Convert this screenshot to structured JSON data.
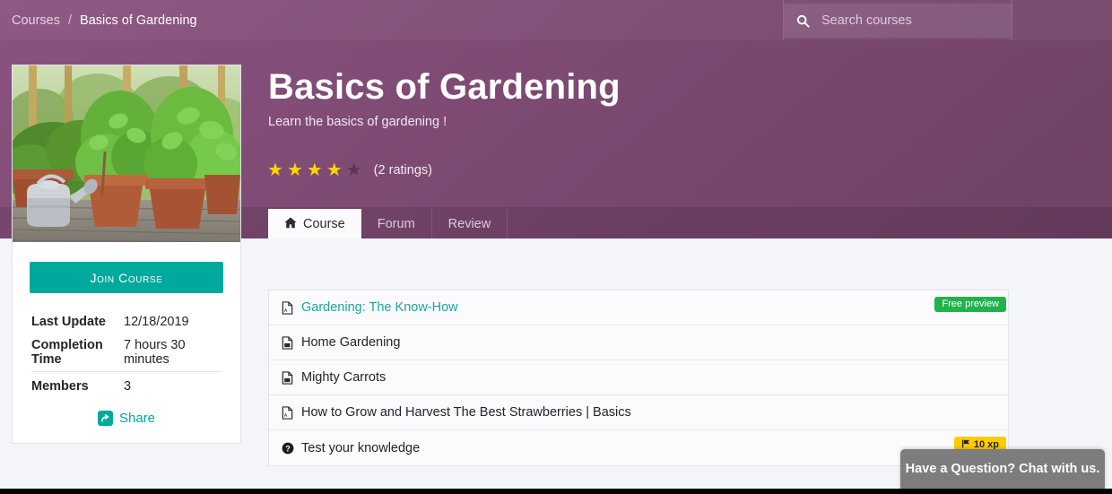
{
  "breadcrumb": {
    "root_label": "Courses",
    "separator": "/",
    "current_label": "Basics of Gardening"
  },
  "search": {
    "placeholder": "Search courses",
    "value": "",
    "icon": "search-icon"
  },
  "hero": {
    "title": "Basics of Gardening",
    "subtitle": "Learn the basics of gardening !",
    "rating_value": 4,
    "rating_max": 5,
    "rating_count_label": "(2 ratings)",
    "star_filled_color": "#ffd400",
    "star_empty_color": "#5d3556",
    "background_color": "#7d4a72"
  },
  "tabs": [
    {
      "label": "Course",
      "icon": "home-icon",
      "active": true
    },
    {
      "label": "Forum",
      "icon": "",
      "active": false
    },
    {
      "label": "Review",
      "icon": "",
      "active": false
    }
  ],
  "sidebar": {
    "thumbnail_alt": "potted garden plants with watering can on a wooden deck",
    "join_button_label": "Join Course",
    "join_button_color": "#00a99d",
    "meta": [
      {
        "key": "Last Update",
        "value": "12/18/2019",
        "divider_above": false
      },
      {
        "key": "Completion Time",
        "value": "7 hours 30 minutes",
        "divider_above": false
      },
      {
        "key": "Members",
        "value": "3",
        "divider_above": true
      }
    ],
    "share_label": "Share",
    "share_icon": "share-icon"
  },
  "content_list": [
    {
      "title": "Gardening: The Know-How",
      "icon": "pdf-file-icon",
      "is_link": true,
      "badge": {
        "type": "free",
        "label": "Free preview",
        "color": "#21b24b"
      }
    },
    {
      "title": "Home Gardening",
      "icon": "image-file-icon",
      "is_link": false,
      "badge": null
    },
    {
      "title": "Mighty Carrots",
      "icon": "image-file-icon",
      "is_link": false,
      "badge": null
    },
    {
      "title": "How to Grow and Harvest The Best Strawberries | Basics",
      "icon": "pdf-file-icon",
      "is_link": false,
      "badge": null
    },
    {
      "title": "Test your knowledge",
      "icon": "question-circle-icon",
      "is_link": false,
      "badge": {
        "type": "xp",
        "label": "10 xp",
        "icon": "flag-icon",
        "color": "#ffcc00"
      }
    }
  ],
  "chat_widget": {
    "label": "Have a Question? Chat with us.",
    "background_color": "#7d7d7d"
  }
}
